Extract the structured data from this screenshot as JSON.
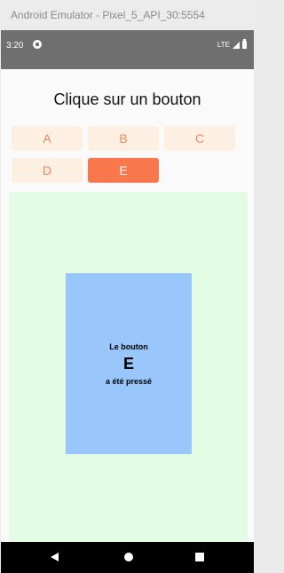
{
  "window": {
    "title": "Android Emulator - Pixel_5_API_30:5554"
  },
  "status_bar": {
    "time": "3:20",
    "network": "LTE",
    "icons": [
      "app-notification-icon",
      "signal-icon",
      "battery-icon"
    ]
  },
  "screen": {
    "heading": "Clique sur un bouton"
  },
  "buttons": [
    {
      "label": "A",
      "selected": false
    },
    {
      "label": "B",
      "selected": false
    },
    {
      "label": "C",
      "selected": false
    },
    {
      "label": "D",
      "selected": false
    },
    {
      "label": "E",
      "selected": true
    }
  ],
  "result": {
    "line1": "Le bouton",
    "letter": "E",
    "line2": "a été pressé"
  },
  "nav_bar": {
    "icons": [
      "back-icon",
      "home-icon",
      "recent-apps-icon"
    ]
  },
  "colors": {
    "button_bg": "#fdf0e2",
    "button_text": "#f3835a",
    "button_selected_bg": "#f8774c",
    "button_selected_text": "#ffffff",
    "result_area_bg": "#e2fde4",
    "card_bg": "#99c6fb",
    "status_bar_bg": "#6f6f6f"
  }
}
